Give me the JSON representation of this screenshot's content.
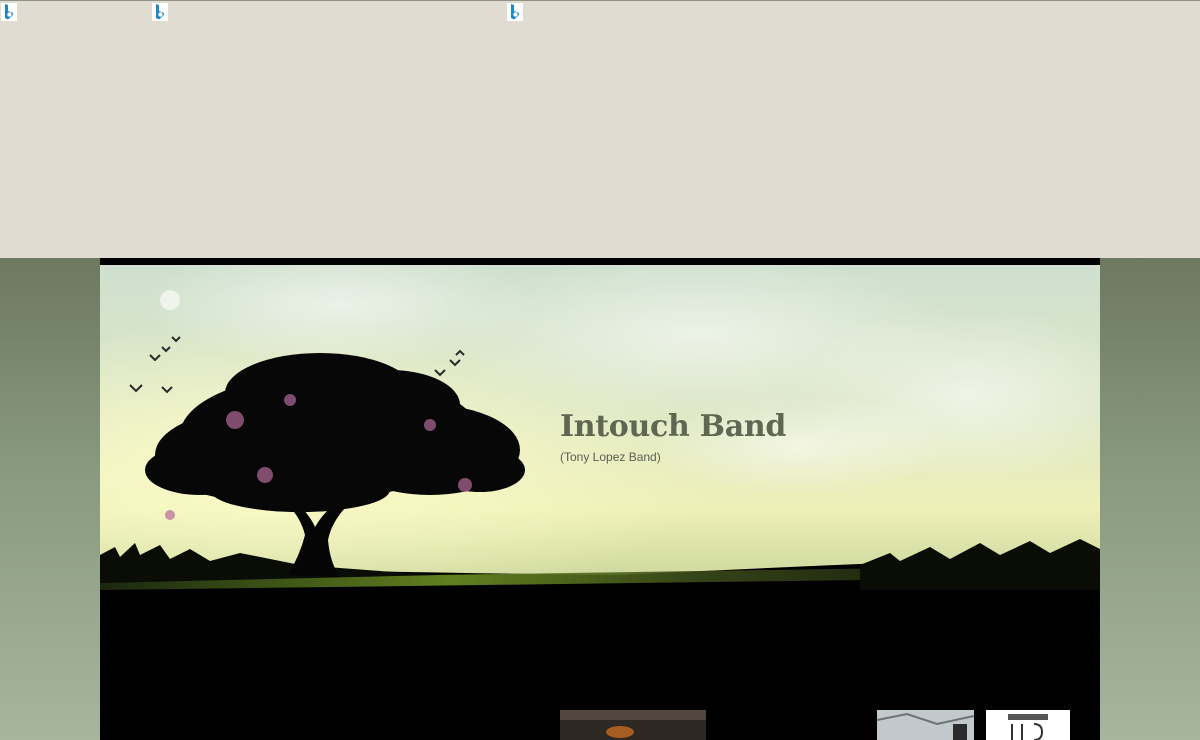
{
  "site": {
    "title": "Intouch Band",
    "subtitle": "(Tony Lopez Band)"
  },
  "ads": {
    "icons": [
      {
        "name": "bing-icon"
      },
      {
        "name": "bing-icon"
      },
      {
        "name": "bing-icon"
      }
    ]
  },
  "colors": {
    "top_band": "#e0dcd1",
    "page_bg": "#6d7860",
    "title_color": "#5f6651",
    "bing_blue": "#1e88c7"
  },
  "gallery": {
    "thumbnails": [
      {
        "name": "photo-thumbnail-1"
      },
      {
        "name": "photo-thumbnail-2"
      },
      {
        "name": "photo-thumbnail-3"
      }
    ]
  }
}
